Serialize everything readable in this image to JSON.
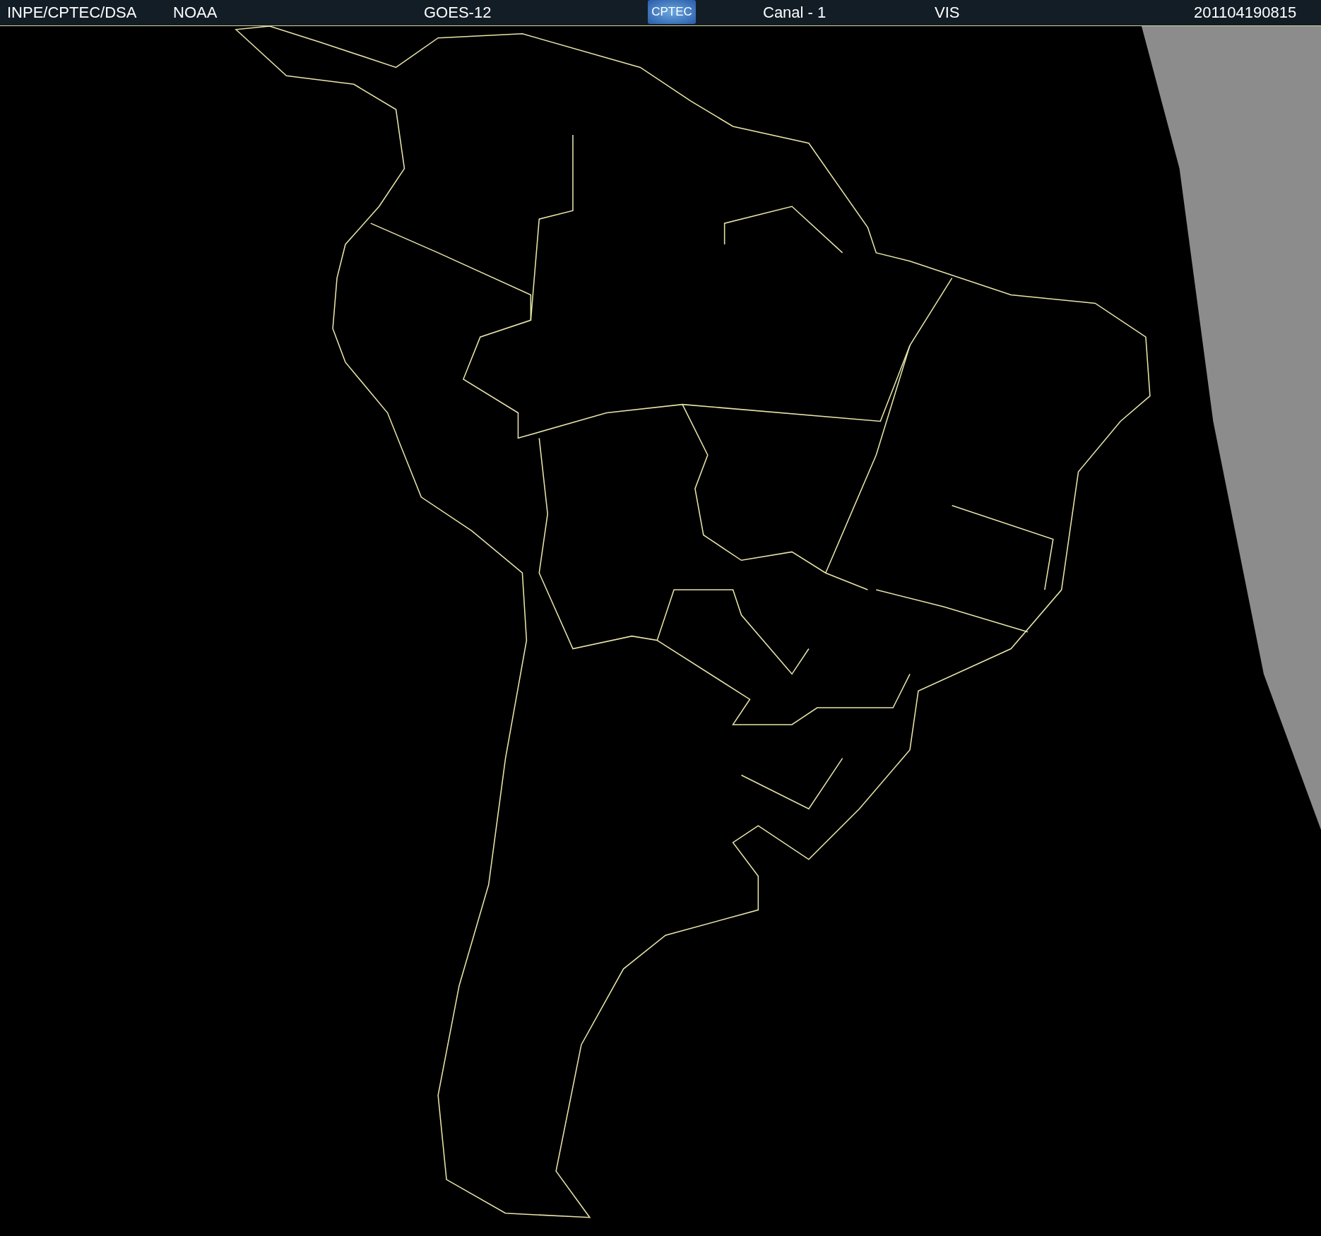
{
  "header": {
    "labels": [
      {
        "text": "INPE/CPTEC/DSA"
      },
      {
        "text": "NOAA"
      },
      {
        "text": "GOES-12"
      }
    ],
    "logo": {
      "text": "CPTEC"
    },
    "right_labels": [
      {
        "text": "Canal - 1"
      },
      {
        "text": "VIS"
      },
      {
        "text": "201104190815"
      }
    ]
  }
}
